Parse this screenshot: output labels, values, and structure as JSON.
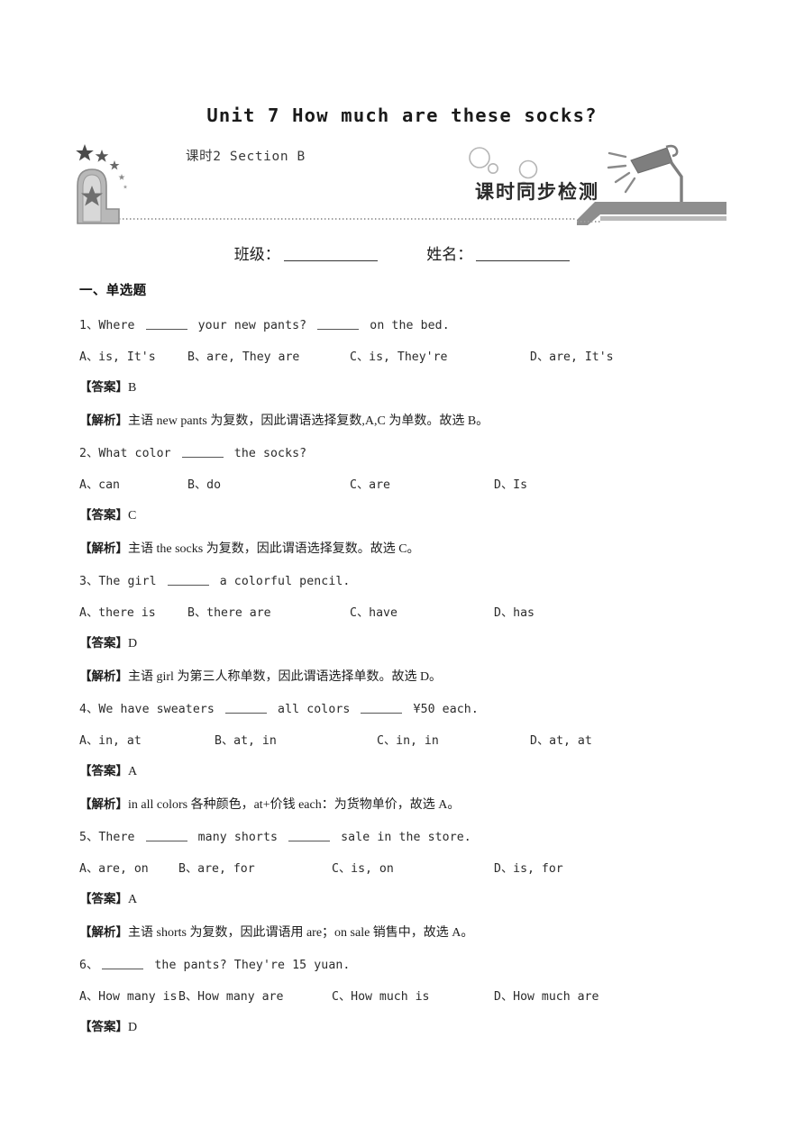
{
  "document": {
    "title": "Unit 7 How much are these socks?",
    "subtitle": "课时2  Section B",
    "banner_label": "课时同步检测"
  },
  "fields": {
    "class_label": "班级：",
    "name_label": "姓名："
  },
  "section": {
    "heading": "一、单选题"
  },
  "answer_tag": "【答案】",
  "analysis_tag": "【解析】",
  "questions": [
    {
      "stem_pre": "1、Where",
      "stem_mid": "your new pants?",
      "stem_post": "on the bed.",
      "blanks": 2,
      "options": [
        "A、is, It's",
        "B、are, They are",
        "C、is, They're",
        "D、are, It's"
      ],
      "option_x": [
        0,
        120,
        300,
        500
      ],
      "answer": "B",
      "analysis": "主语 new pants 为复数，因此谓语选择复数,A,C 为单数。故选 B。"
    },
    {
      "stem_pre": "2、What color",
      "stem_mid": "the socks?",
      "stem_post": "",
      "blanks": 1,
      "options": [
        "A、can",
        "B、do",
        "C、are",
        "D、Is"
      ],
      "option_x": [
        0,
        120,
        300,
        460
      ],
      "answer": "C",
      "analysis": "主语 the socks 为复数，因此谓语选择复数。故选 C。"
    },
    {
      "stem_pre": "3、The girl",
      "stem_mid": "a colorful pencil.",
      "stem_post": "",
      "blanks": 1,
      "options": [
        "A、there is",
        "B、there are",
        "C、have",
        "D、has"
      ],
      "option_x": [
        0,
        120,
        300,
        460
      ],
      "answer": "D",
      "analysis": "主语 girl 为第三人称单数，因此谓语选择单数。故选 D。"
    },
    {
      "stem_pre": "4、We have sweaters",
      "stem_mid": "all colors",
      "stem_post": "¥50 each.",
      "blanks": 2,
      "options": [
        "A、in, at",
        "B、at, in",
        "C、in, in",
        "D、at, at"
      ],
      "option_x": [
        0,
        150,
        330,
        500
      ],
      "answer": "A",
      "analysis": "in all colors 各种颜色，at+价钱 each：为货物单价，故选 A。"
    },
    {
      "stem_pre": "5、There",
      "stem_mid": "many shorts",
      "stem_post": "sale in the store.",
      "blanks": 2,
      "options": [
        "A、are, on",
        "B、are, for",
        "C、is, on",
        "D、is, for"
      ],
      "option_x": [
        0,
        110,
        280,
        460
      ],
      "answer": "A",
      "analysis": "主语 shorts 为复数，因此谓语用 are；on sale 销售中，故选 A。"
    },
    {
      "stem_pre": "6、",
      "stem_mid": "the pants? They're 15 yuan.",
      "stem_post": "",
      "blanks": 1,
      "options": [
        "A、How many is",
        "B、How many are",
        "C、How much is",
        "D、How much are"
      ],
      "option_x": [
        0,
        110,
        280,
        460
      ],
      "answer": "D",
      "analysis": ""
    }
  ],
  "decor": {
    "emblem": "star-emblem",
    "lamp": "desk-lamp",
    "bubbles": "bubbles",
    "dotted_rule": "dotted-rule"
  },
  "colors": {
    "gray_dark": "#7d7d7d",
    "gray_mid": "#a6a6a6",
    "gray_light": "#c9c9c9",
    "text": "#231f20"
  }
}
